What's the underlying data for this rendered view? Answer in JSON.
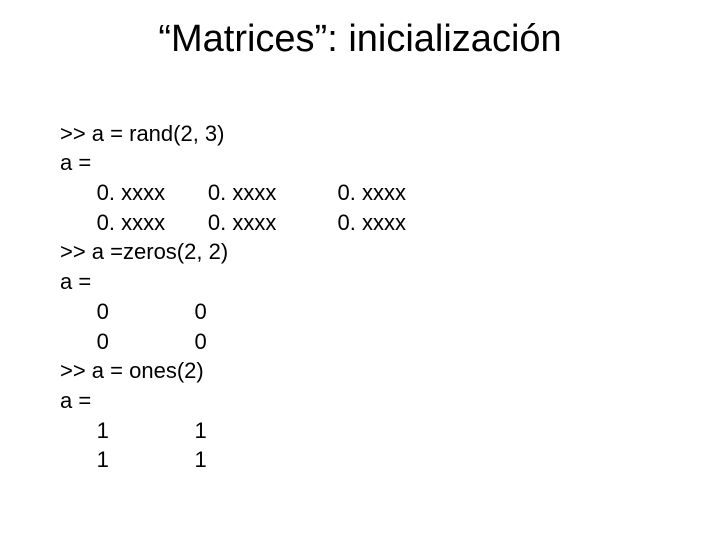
{
  "title": "“Matrices”: inicialización",
  "code": {
    "l01": ">> a = rand(2, 3)",
    "l02": "a =",
    "l03": "      0. xxxx       0. xxxx          0. xxxx",
    "l04": "      0. xxxx       0. xxxx          0. xxxx",
    "l05": ">> a =zeros(2, 2)",
    "l06": "a =",
    "l07": "      0              0",
    "l08": "      0              0",
    "l09": ">> a = ones(2)",
    "l10": "a =",
    "l11": "      1              1",
    "l12": "      1              1"
  }
}
